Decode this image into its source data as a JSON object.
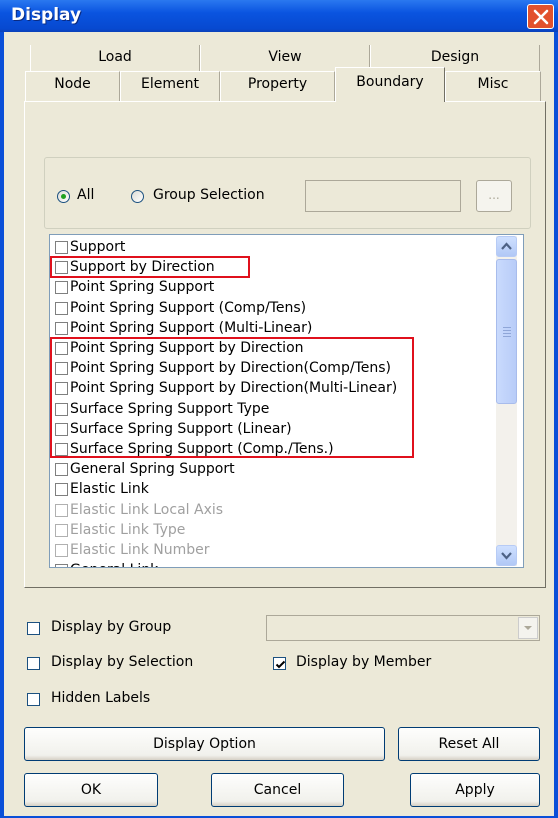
{
  "window": {
    "title": "Display"
  },
  "tabs": {
    "back_row": [
      "Load",
      "View",
      "Design"
    ],
    "front_row": [
      "Node",
      "Element",
      "Property",
      "Boundary",
      "Misc"
    ],
    "active": "Boundary"
  },
  "selection": {
    "all_label": "All",
    "group_label": "Group Selection",
    "group_value": "",
    "browse_label": "..."
  },
  "list": {
    "items": [
      {
        "label": "Support",
        "checked": false,
        "enabled": true
      },
      {
        "label": "Support by Direction",
        "checked": false,
        "enabled": true
      },
      {
        "label": "Point Spring Support",
        "checked": false,
        "enabled": true
      },
      {
        "label": "Point Spring Support (Comp/Tens)",
        "checked": false,
        "enabled": true
      },
      {
        "label": "Point Spring Support (Multi-Linear)",
        "checked": false,
        "enabled": true
      },
      {
        "label": "Point Spring Support by Direction",
        "checked": false,
        "enabled": true
      },
      {
        "label": "Point Spring Support by Direction(Comp/Tens)",
        "checked": false,
        "enabled": true
      },
      {
        "label": "Point Spring Support by Direction(Multi-Linear)",
        "checked": false,
        "enabled": true
      },
      {
        "label": "Surface Spring Support Type",
        "checked": false,
        "enabled": true
      },
      {
        "label": "Surface Spring Support (Linear)",
        "checked": false,
        "enabled": true
      },
      {
        "label": "Surface Spring Support (Comp./Tens.)",
        "checked": false,
        "enabled": true
      },
      {
        "label": "General Spring Support",
        "checked": false,
        "enabled": true
      },
      {
        "label": "Elastic Link",
        "checked": false,
        "enabled": true
      },
      {
        "label": "Elastic Link Local Axis",
        "checked": false,
        "enabled": false
      },
      {
        "label": "Elastic Link Type",
        "checked": false,
        "enabled": false
      },
      {
        "label": "Elastic Link Number",
        "checked": false,
        "enabled": false
      },
      {
        "label": "General Link",
        "checked": false,
        "enabled": true
      }
    ]
  },
  "options": {
    "display_by_group": "Display by Group",
    "display_by_selection": "Display by Selection",
    "display_by_member": "Display by Member",
    "hidden_labels": "Hidden Labels",
    "group_combo_value": ""
  },
  "buttons": {
    "display_option": "Display Option",
    "reset_all": "Reset All",
    "ok": "OK",
    "cancel": "Cancel",
    "apply": "Apply"
  },
  "colors": {
    "title_bar": "#0a54e0",
    "highlight": "#e0101c",
    "dialog_bg": "#ece9d8"
  }
}
